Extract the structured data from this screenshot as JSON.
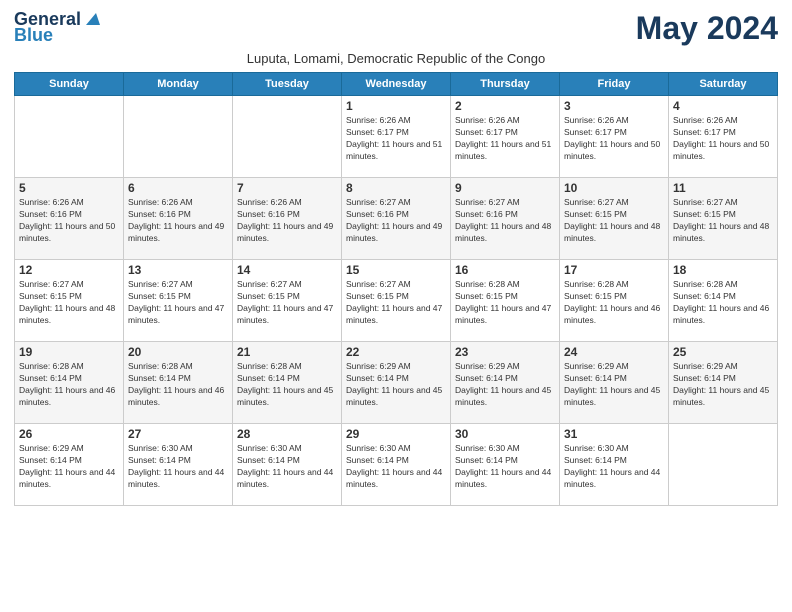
{
  "logo": {
    "general": "General",
    "blue": "Blue"
  },
  "title": "May 2024",
  "subtitle": "Luputa, Lomami, Democratic Republic of the Congo",
  "days_of_week": [
    "Sunday",
    "Monday",
    "Tuesday",
    "Wednesday",
    "Thursday",
    "Friday",
    "Saturday"
  ],
  "weeks": [
    [
      {
        "day": "",
        "info": ""
      },
      {
        "day": "",
        "info": ""
      },
      {
        "day": "",
        "info": ""
      },
      {
        "day": "1",
        "info": "Sunrise: 6:26 AM\nSunset: 6:17 PM\nDaylight: 11 hours and 51 minutes."
      },
      {
        "day": "2",
        "info": "Sunrise: 6:26 AM\nSunset: 6:17 PM\nDaylight: 11 hours and 51 minutes."
      },
      {
        "day": "3",
        "info": "Sunrise: 6:26 AM\nSunset: 6:17 PM\nDaylight: 11 hours and 50 minutes."
      },
      {
        "day": "4",
        "info": "Sunrise: 6:26 AM\nSunset: 6:17 PM\nDaylight: 11 hours and 50 minutes."
      }
    ],
    [
      {
        "day": "5",
        "info": "Sunrise: 6:26 AM\nSunset: 6:16 PM\nDaylight: 11 hours and 50 minutes."
      },
      {
        "day": "6",
        "info": "Sunrise: 6:26 AM\nSunset: 6:16 PM\nDaylight: 11 hours and 49 minutes."
      },
      {
        "day": "7",
        "info": "Sunrise: 6:26 AM\nSunset: 6:16 PM\nDaylight: 11 hours and 49 minutes."
      },
      {
        "day": "8",
        "info": "Sunrise: 6:27 AM\nSunset: 6:16 PM\nDaylight: 11 hours and 49 minutes."
      },
      {
        "day": "9",
        "info": "Sunrise: 6:27 AM\nSunset: 6:16 PM\nDaylight: 11 hours and 48 minutes."
      },
      {
        "day": "10",
        "info": "Sunrise: 6:27 AM\nSunset: 6:15 PM\nDaylight: 11 hours and 48 minutes."
      },
      {
        "day": "11",
        "info": "Sunrise: 6:27 AM\nSunset: 6:15 PM\nDaylight: 11 hours and 48 minutes."
      }
    ],
    [
      {
        "day": "12",
        "info": "Sunrise: 6:27 AM\nSunset: 6:15 PM\nDaylight: 11 hours and 48 minutes."
      },
      {
        "day": "13",
        "info": "Sunrise: 6:27 AM\nSunset: 6:15 PM\nDaylight: 11 hours and 47 minutes."
      },
      {
        "day": "14",
        "info": "Sunrise: 6:27 AM\nSunset: 6:15 PM\nDaylight: 11 hours and 47 minutes."
      },
      {
        "day": "15",
        "info": "Sunrise: 6:27 AM\nSunset: 6:15 PM\nDaylight: 11 hours and 47 minutes."
      },
      {
        "day": "16",
        "info": "Sunrise: 6:28 AM\nSunset: 6:15 PM\nDaylight: 11 hours and 47 minutes."
      },
      {
        "day": "17",
        "info": "Sunrise: 6:28 AM\nSunset: 6:15 PM\nDaylight: 11 hours and 46 minutes."
      },
      {
        "day": "18",
        "info": "Sunrise: 6:28 AM\nSunset: 6:14 PM\nDaylight: 11 hours and 46 minutes."
      }
    ],
    [
      {
        "day": "19",
        "info": "Sunrise: 6:28 AM\nSunset: 6:14 PM\nDaylight: 11 hours and 46 minutes."
      },
      {
        "day": "20",
        "info": "Sunrise: 6:28 AM\nSunset: 6:14 PM\nDaylight: 11 hours and 46 minutes."
      },
      {
        "day": "21",
        "info": "Sunrise: 6:28 AM\nSunset: 6:14 PM\nDaylight: 11 hours and 45 minutes."
      },
      {
        "day": "22",
        "info": "Sunrise: 6:29 AM\nSunset: 6:14 PM\nDaylight: 11 hours and 45 minutes."
      },
      {
        "day": "23",
        "info": "Sunrise: 6:29 AM\nSunset: 6:14 PM\nDaylight: 11 hours and 45 minutes."
      },
      {
        "day": "24",
        "info": "Sunrise: 6:29 AM\nSunset: 6:14 PM\nDaylight: 11 hours and 45 minutes."
      },
      {
        "day": "25",
        "info": "Sunrise: 6:29 AM\nSunset: 6:14 PM\nDaylight: 11 hours and 45 minutes."
      }
    ],
    [
      {
        "day": "26",
        "info": "Sunrise: 6:29 AM\nSunset: 6:14 PM\nDaylight: 11 hours and 44 minutes."
      },
      {
        "day": "27",
        "info": "Sunrise: 6:30 AM\nSunset: 6:14 PM\nDaylight: 11 hours and 44 minutes."
      },
      {
        "day": "28",
        "info": "Sunrise: 6:30 AM\nSunset: 6:14 PM\nDaylight: 11 hours and 44 minutes."
      },
      {
        "day": "29",
        "info": "Sunrise: 6:30 AM\nSunset: 6:14 PM\nDaylight: 11 hours and 44 minutes."
      },
      {
        "day": "30",
        "info": "Sunrise: 6:30 AM\nSunset: 6:14 PM\nDaylight: 11 hours and 44 minutes."
      },
      {
        "day": "31",
        "info": "Sunrise: 6:30 AM\nSunset: 6:14 PM\nDaylight: 11 hours and 44 minutes."
      },
      {
        "day": "",
        "info": ""
      }
    ]
  ]
}
